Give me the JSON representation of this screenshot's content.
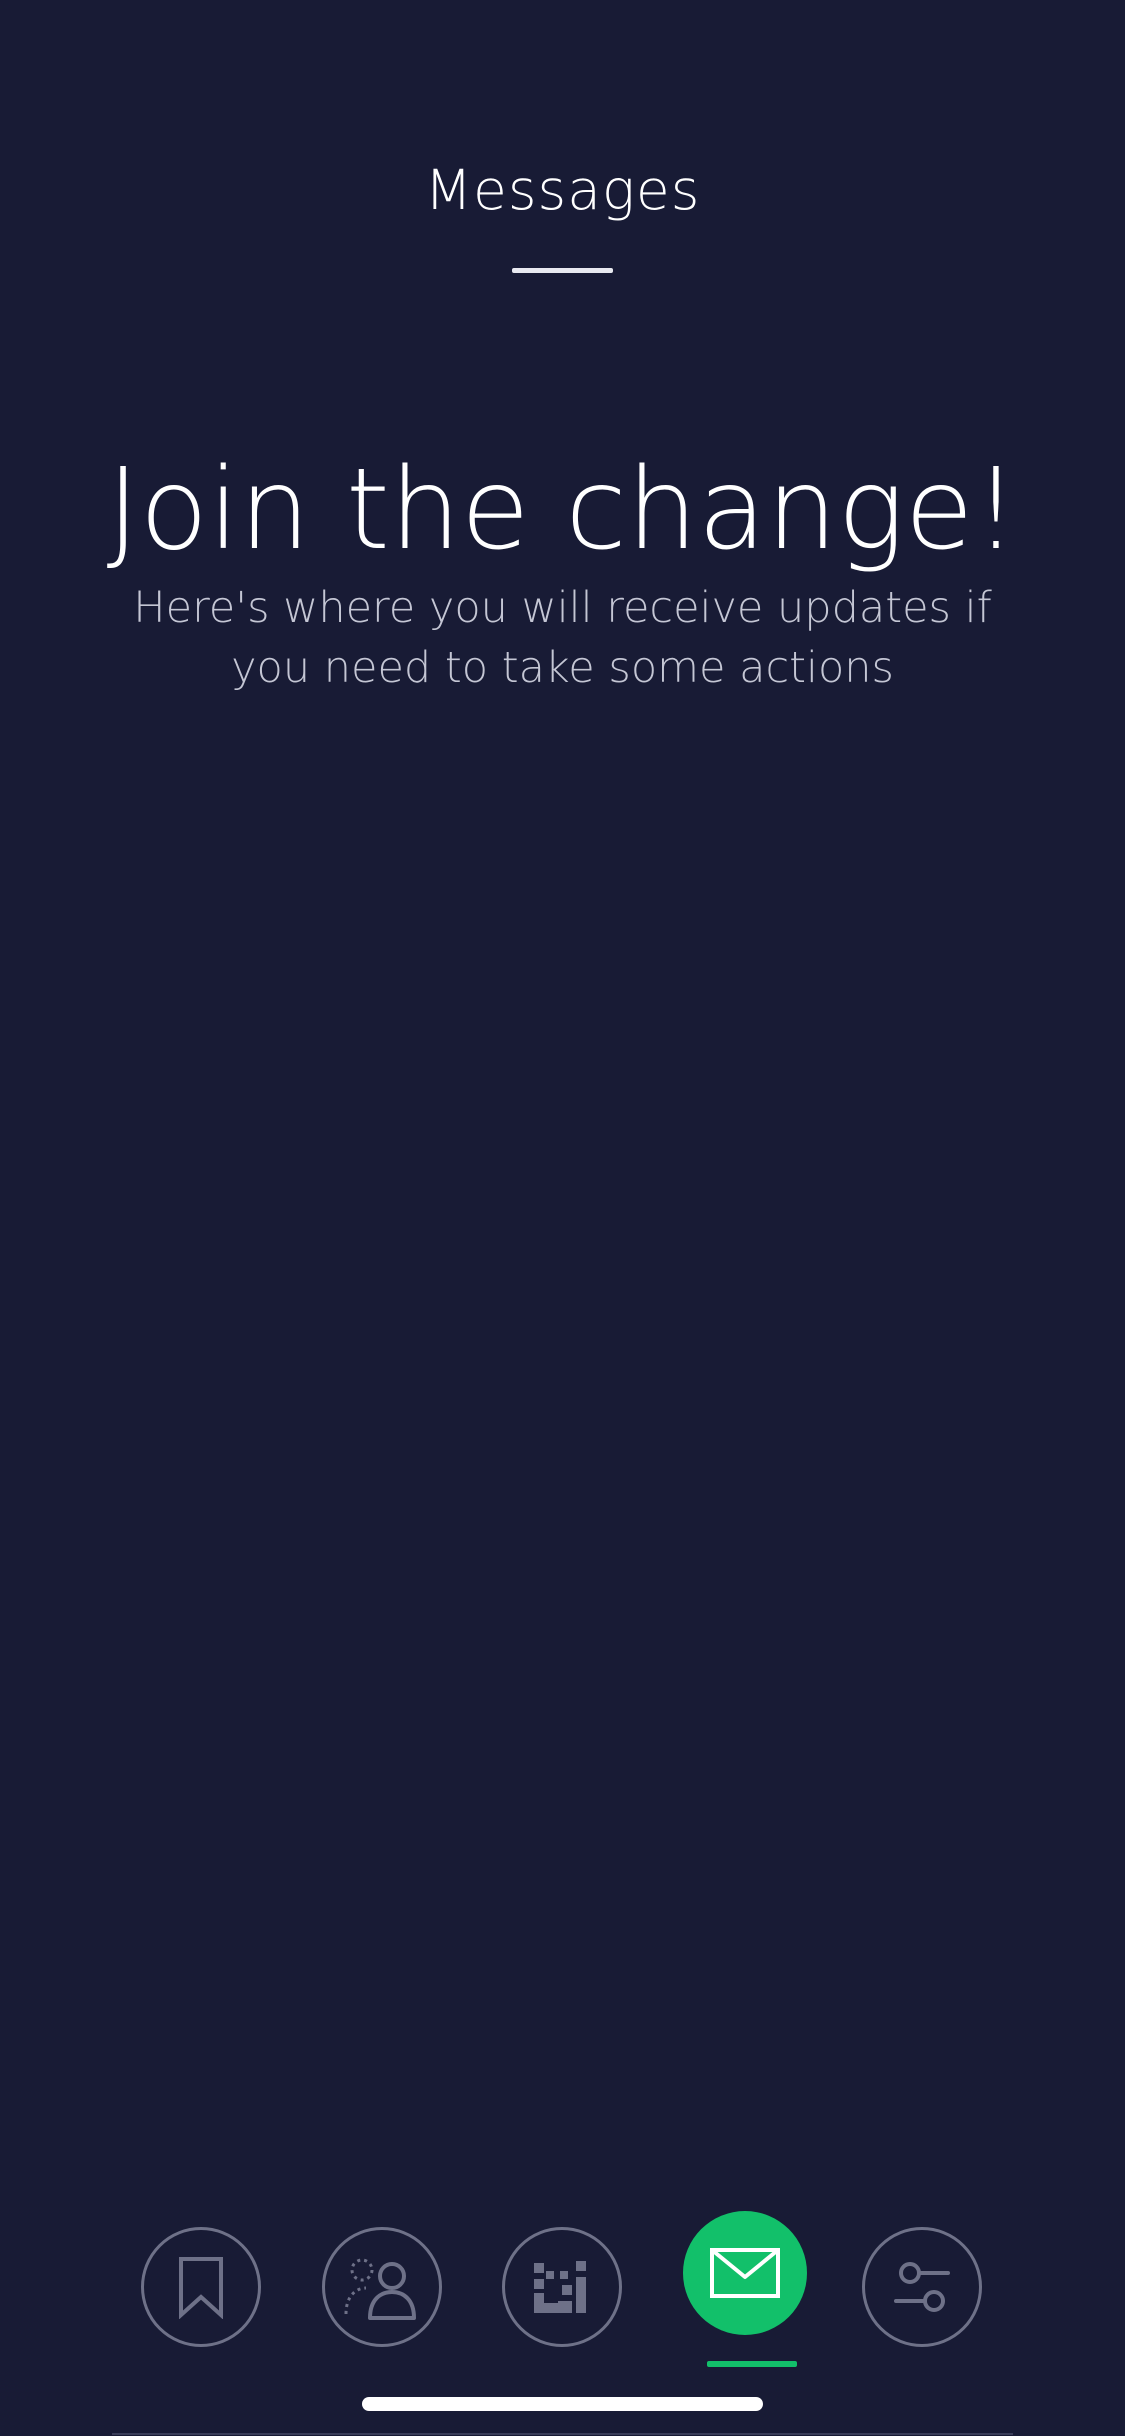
{
  "header": {
    "title": "Messages"
  },
  "empty_state": {
    "title": "Join the change!",
    "subtitle": "Here's where you will receive updates if you need to take some actions"
  },
  "tabbar": {
    "active_tab": "messages",
    "accent_color": "#12c06a",
    "tabs": [
      {
        "id": "saved",
        "icon": "bookmark-icon"
      },
      {
        "id": "people",
        "icon": "people-icon"
      },
      {
        "id": "scan",
        "icon": "qr-code-icon"
      },
      {
        "id": "messages",
        "icon": "envelope-icon"
      },
      {
        "id": "settings",
        "icon": "sliders-icon"
      }
    ]
  },
  "colors": {
    "background": "#181b35",
    "text_primary": "#ffffff",
    "text_secondary": "#c4c6d4",
    "icon_inactive": "#6e7188"
  }
}
